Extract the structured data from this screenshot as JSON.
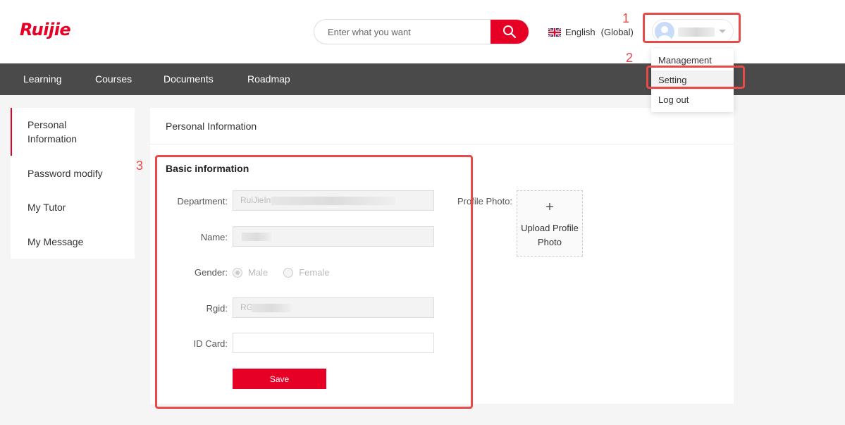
{
  "header": {
    "logo": "Ruijie",
    "search_placeholder": "Enter what you want",
    "language": "English",
    "region": "(Global)"
  },
  "nav": {
    "items": [
      "Learning",
      "Courses",
      "Documents",
      "Roadmap"
    ]
  },
  "user_menu": {
    "items": [
      "Management",
      "Setting",
      "Log out"
    ]
  },
  "sidebar": {
    "items": [
      "Personal Information",
      "Password modify",
      "My Tutor",
      "My Message"
    ]
  },
  "main": {
    "title": "Personal Information",
    "section_title": "Basic information",
    "fields": {
      "department_label": "Department:",
      "department_value": "RuiJieIn",
      "name_label": "Name:",
      "gender_label": "Gender:",
      "gender_male": "Male",
      "gender_female": "Female",
      "rgid_label": "Rgid:",
      "rgid_value": "RG",
      "idcard_label": "ID Card:"
    },
    "save_label": "Save",
    "photo_label": "Profile Photo:",
    "upload_plus": "+",
    "upload_text": "Upload Profile Photo"
  },
  "annotations": [
    "1",
    "2",
    "3"
  ],
  "colors": {
    "brand": "#e60026",
    "navbar": "#4a4a4a",
    "annotation": "#e84a4a"
  }
}
